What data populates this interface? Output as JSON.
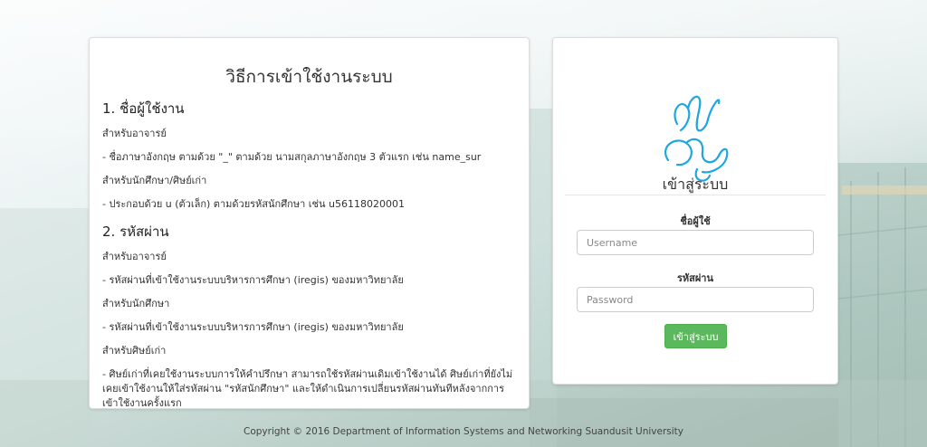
{
  "instructions": {
    "title": "วิธีการเข้าใช้งานระบบ",
    "section1_heading": "1. ชื่อผู้ใช้งาน",
    "s1_teacher_label": "สำหรับอาจารย์",
    "s1_teacher_text": "- ชื่อภาษาอังกฤษ ตามด้วย \"_\" ตามด้วย นามสกุลภาษาอังกฤษ 3 ตัวแรก เช่น name_sur",
    "s1_student_label": "สำหรับนักศึกษา/ศิษย์เก่า",
    "s1_student_text": "- ประกอบด้วย u (ตัวเล็ก) ตามด้วยรหัสนักศึกษา เช่น u56118020001",
    "section2_heading": "2. รหัสผ่าน",
    "s2_teacher_label": "สำหรับอาจารย์",
    "s2_teacher_text": "- รหัสผ่านที่เข้าใช้งานระบบบริหารการศึกษา (iregis) ของมหาวิทยาลัย",
    "s2_student_label": "สำหรับนักศึกษา",
    "s2_student_text": "- รหัสผ่านที่เข้าใช้งานระบบบริหารการศึกษา (iregis) ของมหาวิทยาลัย",
    "s2_alumni_label": "สำหรับศิษย์เก่า",
    "s2_alumni_text": "- ศิษย์เก่าที่เคยใช้งานระบบการให้คำปรึกษา สามารถใช้รหัสผ่านเดิมเข้าใช้งานได้ ศิษย์เก่าที่ยังไม่เคยเข้าใช้งานให้ใส่รหัสผ่าน \"รหัสนักศึกษา\" และให้ดำเนินการเปลี่ยนรหัสผ่านทันทีหลังจากการเข้าใช้งานครั้งแรก"
  },
  "login": {
    "title": "เข้าสู่ระบบ",
    "username_label": "ชื่อผู้ใช้",
    "username_placeholder": "Username",
    "username_value": "",
    "password_label": "รหัสผ่าน",
    "password_placeholder": "Password",
    "password_value": "",
    "submit_label": "เข้าสู่ระบบ"
  },
  "logo": {
    "icon": "university-signature-logo",
    "color": "#1fa6e0"
  },
  "footer": {
    "copyright": "Copyright © 2016 Department of Information Systems and Networking Suandusit University"
  },
  "colors": {
    "primary_button": "#5cb85c",
    "panel_bg": "#ffffff"
  }
}
